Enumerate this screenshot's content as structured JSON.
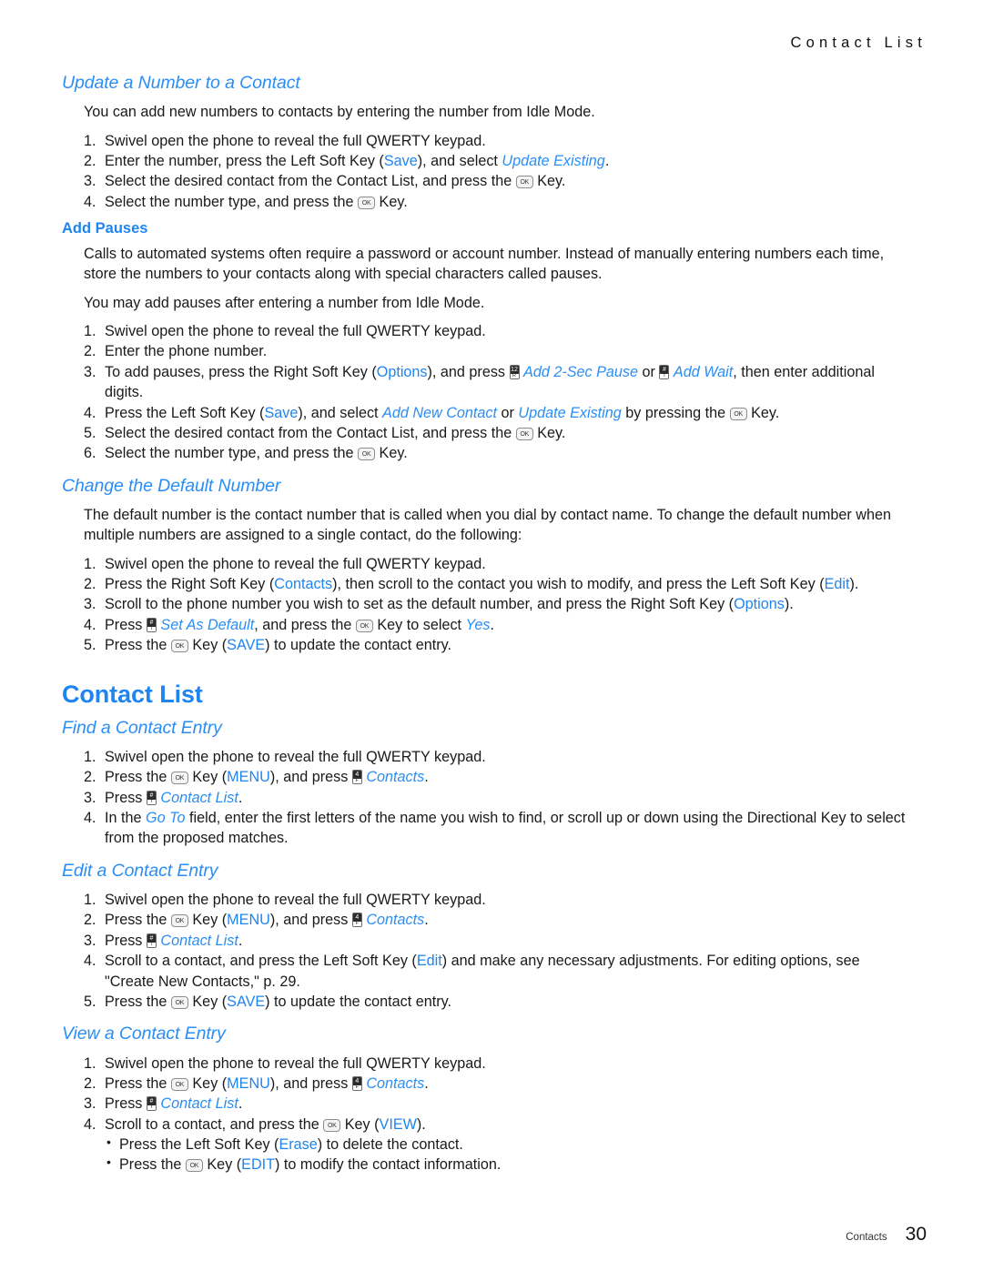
{
  "header": {
    "running_title": "Contact List"
  },
  "footer": {
    "section_label": "Contacts",
    "page_number": "30"
  },
  "colors": {
    "accent_blue": "#1e85f0",
    "accent_blue_italic": "#2a8ef5",
    "body_text": "#1a1a1a"
  },
  "icons": {
    "ok_key": "OK",
    "pad_key_2sec": {
      "top": "12",
      "bottom": "R"
    },
    "pad_key_wait": {
      "top": "#",
      "bottom": "T"
    },
    "pad_key_set_default": {
      "top": "#",
      "bottom": "T"
    },
    "pad_key_contacts": {
      "top": "4",
      "bottom": "F"
    },
    "pad_key_contact_list": {
      "top": "#",
      "bottom": "T"
    }
  },
  "sections": {
    "update_number": {
      "title": "Update a Number to a Contact",
      "intro": "You can add new numbers to contacts by entering the number from Idle Mode.",
      "steps": [
        {
          "n": "1.",
          "parts": [
            {
              "t": "Swivel open the phone to reveal the full QWERTY keypad."
            }
          ]
        },
        {
          "n": "2.",
          "parts": [
            {
              "t": "Enter the number, press the Left Soft Key ("
            },
            {
              "t": "Save",
              "s": "hl"
            },
            {
              "t": "), and select "
            },
            {
              "t": "Update Existing",
              "s": "hl-i"
            },
            {
              "t": "."
            }
          ]
        },
        {
          "n": "3.",
          "parts": [
            {
              "t": "Select the desired contact from the Contact List, and press the "
            },
            {
              "icon": "ok"
            },
            {
              "t": " Key."
            }
          ]
        },
        {
          "n": "4.",
          "parts": [
            {
              "t": "Select the number type, and press the "
            },
            {
              "icon": "ok"
            },
            {
              "t": " Key."
            }
          ]
        }
      ]
    },
    "add_pauses": {
      "title": "Add Pauses",
      "para1": "Calls to automated systems often require a password or account number. Instead of manually entering numbers each time, store the numbers to your contacts along with special characters called pauses.",
      "para2": "You may add pauses after entering a number from Idle Mode.",
      "steps": [
        {
          "n": "1.",
          "parts": [
            {
              "t": "Swivel open the phone to reveal the full QWERTY keypad."
            }
          ]
        },
        {
          "n": "2.",
          "parts": [
            {
              "t": "Enter the phone number."
            }
          ]
        },
        {
          "n": "3.",
          "parts": [
            {
              "t": "To add pauses, press the Right Soft Key ("
            },
            {
              "t": "Options",
              "s": "hl"
            },
            {
              "t": "), and press "
            },
            {
              "icon": "pad",
              "key": "pad_key_2sec"
            },
            {
              "t": " "
            },
            {
              "t": "Add 2-Sec Pause",
              "s": "hl-i"
            },
            {
              "t": " or "
            },
            {
              "icon": "pad",
              "key": "pad_key_wait"
            },
            {
              "t": " "
            },
            {
              "t": "Add Wait",
              "s": "hl-i"
            },
            {
              "t": ", then enter additional digits."
            }
          ]
        },
        {
          "n": "4.",
          "parts": [
            {
              "t": "Press the Left Soft Key ("
            },
            {
              "t": "Save",
              "s": "hl"
            },
            {
              "t": "), and select "
            },
            {
              "t": "Add New Contact",
              "s": "hl-i"
            },
            {
              "t": " or "
            },
            {
              "t": "Update Existing",
              "s": "hl-i"
            },
            {
              "t": " by pressing the "
            },
            {
              "icon": "ok"
            },
            {
              "t": " Key."
            }
          ]
        },
        {
          "n": "5.",
          "parts": [
            {
              "t": "Select the desired contact from the Contact List, and press the "
            },
            {
              "icon": "ok"
            },
            {
              "t": " Key."
            }
          ]
        },
        {
          "n": "6.",
          "parts": [
            {
              "t": "Select the number type, and press the "
            },
            {
              "icon": "ok"
            },
            {
              "t": " Key."
            }
          ]
        }
      ]
    },
    "change_default": {
      "title": "Change the Default Number",
      "intro": "The default number is the contact number that is called when you dial by contact name. To change the default number when multiple numbers are assigned to a single contact, do the following:",
      "steps": [
        {
          "n": "1.",
          "parts": [
            {
              "t": "Swivel open the phone to reveal the full QWERTY keypad."
            }
          ]
        },
        {
          "n": "2.",
          "parts": [
            {
              "t": "Press the Right Soft Key ("
            },
            {
              "t": "Contacts",
              "s": "hl"
            },
            {
              "t": "), then scroll to the contact you wish to modify, and press the Left Soft Key ("
            },
            {
              "t": "Edit",
              "s": "hl"
            },
            {
              "t": ")."
            }
          ]
        },
        {
          "n": "3.",
          "parts": [
            {
              "t": "Scroll to the phone number you wish to set as the default number, and press the Right Soft Key ("
            },
            {
              "t": "Options",
              "s": "hl"
            },
            {
              "t": ")."
            }
          ]
        },
        {
          "n": "4.",
          "parts": [
            {
              "t": "Press "
            },
            {
              "icon": "pad",
              "key": "pad_key_set_default"
            },
            {
              "t": " "
            },
            {
              "t": "Set As Default",
              "s": "hl-i"
            },
            {
              "t": ", and press the "
            },
            {
              "icon": "ok"
            },
            {
              "t": " Key to select "
            },
            {
              "t": "Yes",
              "s": "hl-i"
            },
            {
              "t": "."
            }
          ]
        },
        {
          "n": "5.",
          "parts": [
            {
              "t": "Press the "
            },
            {
              "icon": "ok"
            },
            {
              "t": " Key ("
            },
            {
              "t": "SAVE",
              "s": "hl"
            },
            {
              "t": ") to update the contact entry."
            }
          ]
        }
      ]
    },
    "contact_list": {
      "title": "Contact List",
      "find": {
        "title": "Find a Contact Entry",
        "steps": [
          {
            "n": "1.",
            "parts": [
              {
                "t": "Swivel open the phone to reveal the full QWERTY keypad."
              }
            ]
          },
          {
            "n": "2.",
            "parts": [
              {
                "t": "Press the "
              },
              {
                "icon": "ok"
              },
              {
                "t": " Key ("
              },
              {
                "t": "MENU",
                "s": "hl"
              },
              {
                "t": "), and press "
              },
              {
                "icon": "pad",
                "key": "pad_key_contacts"
              },
              {
                "t": " "
              },
              {
                "t": "Contacts",
                "s": "hl-i"
              },
              {
                "t": "."
              }
            ]
          },
          {
            "n": "3.",
            "parts": [
              {
                "t": "Press "
              },
              {
                "icon": "pad",
                "key": "pad_key_contact_list"
              },
              {
                "t": " "
              },
              {
                "t": "Contact List",
                "s": "hl-i"
              },
              {
                "t": "."
              }
            ]
          },
          {
            "n": "4.",
            "parts": [
              {
                "t": "In the "
              },
              {
                "t": "Go To",
                "s": "hl-i"
              },
              {
                "t": " field, enter the first letters of the name you wish to find, or scroll up or down using the Directional Key to select from the proposed matches."
              }
            ]
          }
        ]
      },
      "edit": {
        "title": "Edit a Contact Entry",
        "steps": [
          {
            "n": "1.",
            "parts": [
              {
                "t": "Swivel open the phone to reveal the full QWERTY keypad."
              }
            ]
          },
          {
            "n": "2.",
            "parts": [
              {
                "t": "Press the "
              },
              {
                "icon": "ok"
              },
              {
                "t": " Key ("
              },
              {
                "t": "MENU",
                "s": "hl"
              },
              {
                "t": "), and press "
              },
              {
                "icon": "pad",
                "key": "pad_key_contacts"
              },
              {
                "t": " "
              },
              {
                "t": "Contacts",
                "s": "hl-i"
              },
              {
                "t": "."
              }
            ]
          },
          {
            "n": "3.",
            "parts": [
              {
                "t": "Press "
              },
              {
                "icon": "pad",
                "key": "pad_key_contact_list"
              },
              {
                "t": " "
              },
              {
                "t": "Contact List",
                "s": "hl-i"
              },
              {
                "t": "."
              }
            ]
          },
          {
            "n": "4.",
            "parts": [
              {
                "t": "Scroll to a contact, and press the Left Soft Key ("
              },
              {
                "t": "Edit",
                "s": "hl"
              },
              {
                "t": ") and make any necessary adjustments. For editing options, see \"Create New Contacts,\" p. 29."
              }
            ]
          },
          {
            "n": "5.",
            "parts": [
              {
                "t": "Press the "
              },
              {
                "icon": "ok"
              },
              {
                "t": " Key ("
              },
              {
                "t": "SAVE",
                "s": "hl"
              },
              {
                "t": ") to update the contact entry."
              }
            ]
          }
        ]
      },
      "view": {
        "title": "View a Contact Entry",
        "steps": [
          {
            "n": "1.",
            "parts": [
              {
                "t": "Swivel open the phone to reveal the full QWERTY keypad."
              }
            ]
          },
          {
            "n": "2.",
            "parts": [
              {
                "t": "Press the "
              },
              {
                "icon": "ok"
              },
              {
                "t": " Key ("
              },
              {
                "t": "MENU",
                "s": "hl"
              },
              {
                "t": "), and press "
              },
              {
                "icon": "pad",
                "key": "pad_key_contacts"
              },
              {
                "t": " "
              },
              {
                "t": "Contacts",
                "s": "hl-i"
              },
              {
                "t": "."
              }
            ]
          },
          {
            "n": "3.",
            "parts": [
              {
                "t": "Press "
              },
              {
                "icon": "pad",
                "key": "pad_key_contact_list"
              },
              {
                "t": " "
              },
              {
                "t": "Contact List",
                "s": "hl-i"
              },
              {
                "t": "."
              }
            ]
          },
          {
            "n": "4.",
            "parts": [
              {
                "t": "Scroll to a contact, and press the "
              },
              {
                "icon": "ok"
              },
              {
                "t": " Key ("
              },
              {
                "t": "VIEW",
                "s": "hl"
              },
              {
                "t": ")."
              }
            ]
          }
        ],
        "bullets": [
          {
            "parts": [
              {
                "t": "Press the Left Soft Key ("
              },
              {
                "t": "Erase",
                "s": "hl"
              },
              {
                "t": ") to delete the contact."
              }
            ]
          },
          {
            "parts": [
              {
                "t": "Press the "
              },
              {
                "icon": "ok"
              },
              {
                "t": " Key ("
              },
              {
                "t": "EDIT",
                "s": "hl"
              },
              {
                "t": ") to modify the contact information."
              }
            ]
          }
        ]
      }
    }
  }
}
